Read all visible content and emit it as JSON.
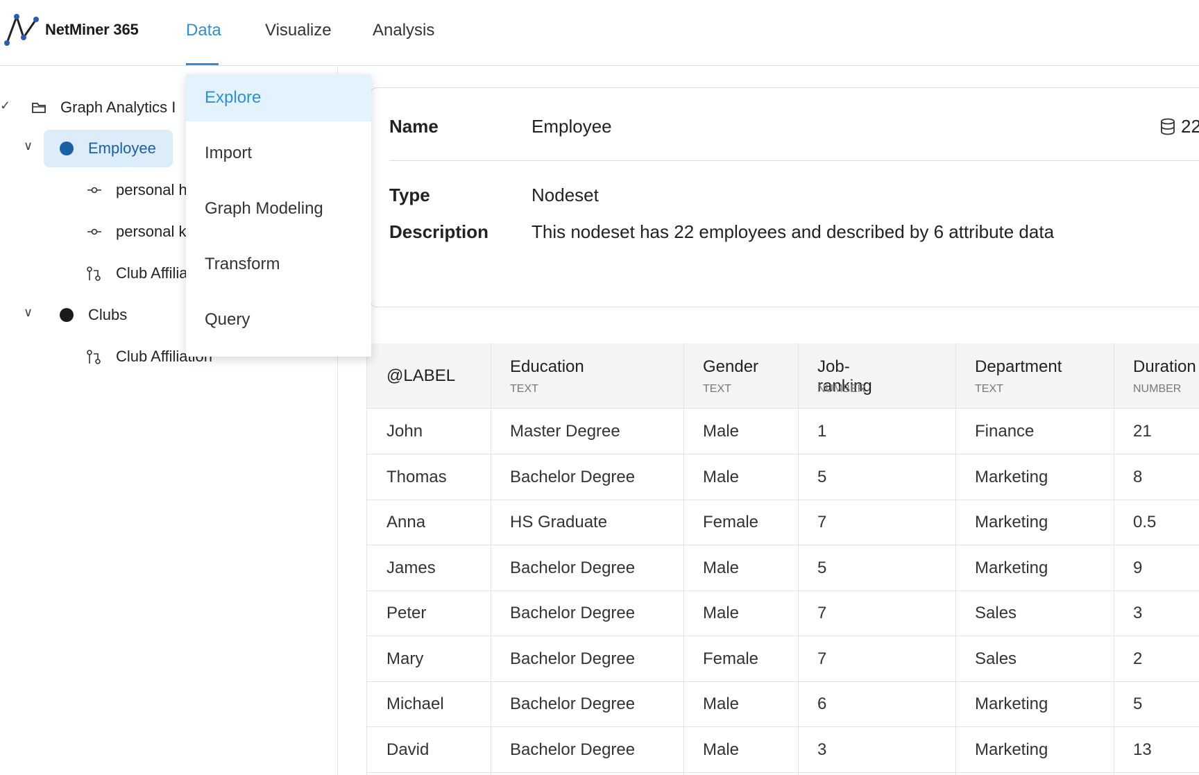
{
  "app": {
    "brand": "NetMiner 365"
  },
  "nav": {
    "tabs": [
      {
        "label": "Data"
      },
      {
        "label": "Visualize"
      },
      {
        "label": "Analysis"
      }
    ],
    "accent_color": "#2e8fd8"
  },
  "dropdown": {
    "items": [
      {
        "label": "Explore"
      },
      {
        "label": "Import"
      },
      {
        "label": "Graph Modeling"
      },
      {
        "label": "Transform"
      },
      {
        "label": "Query"
      }
    ]
  },
  "tree": {
    "project": {
      "label": "Graph Analytics I",
      "icon": "folder-icon"
    },
    "nodes": [
      {
        "label": "Employee",
        "icon": "node-dot-icon"
      },
      {
        "label": "personal h",
        "icon": "link-icon"
      },
      {
        "label": "personal k",
        "icon": "link-icon"
      },
      {
        "label": "Club Affilia",
        "icon": "bipartite-link-icon"
      },
      {
        "label": "Clubs",
        "icon": "node-dot-icon"
      },
      {
        "label": "Club Affiliation",
        "icon": "bipartite-link-icon"
      }
    ]
  },
  "detail": {
    "name_label": "Name",
    "name_value": "Employee",
    "count": "22",
    "type_label": "Type",
    "type_value": "Nodeset",
    "description_label": "Description",
    "description_value": "This nodeset has 22 employees and described by 6 attribute data"
  },
  "table": {
    "columns": [
      {
        "name": "@LABEL",
        "type": ""
      },
      {
        "name": "Education",
        "type": "TEXT"
      },
      {
        "name": "Gender",
        "type": "TEXT"
      },
      {
        "name": "Job-ranking",
        "type": "NUMBER"
      },
      {
        "name": "Department",
        "type": "TEXT"
      },
      {
        "name": "Duration",
        "type": "NUMBER"
      }
    ],
    "rows": [
      [
        "John",
        "Master Degree",
        "Male",
        "1",
        "Finance",
        "21"
      ],
      [
        "Thomas",
        "Bachelor Degree",
        "Male",
        "5",
        "Marketing",
        "8"
      ],
      [
        "Anna",
        "HS Graduate",
        "Female",
        "7",
        "Marketing",
        "0.5"
      ],
      [
        "James",
        "Bachelor Degree",
        "Male",
        "5",
        "Marketing",
        "9"
      ],
      [
        "Peter",
        "Bachelor Degree",
        "Male",
        "7",
        "Sales",
        "3"
      ],
      [
        "Mary",
        "Bachelor Degree",
        "Female",
        "7",
        "Sales",
        "2"
      ],
      [
        "Michael",
        "Bachelor Degree",
        "Male",
        "6",
        "Marketing",
        "5"
      ],
      [
        "David",
        "Bachelor Degree",
        "Male",
        "3",
        "Marketing",
        "13"
      ]
    ]
  }
}
